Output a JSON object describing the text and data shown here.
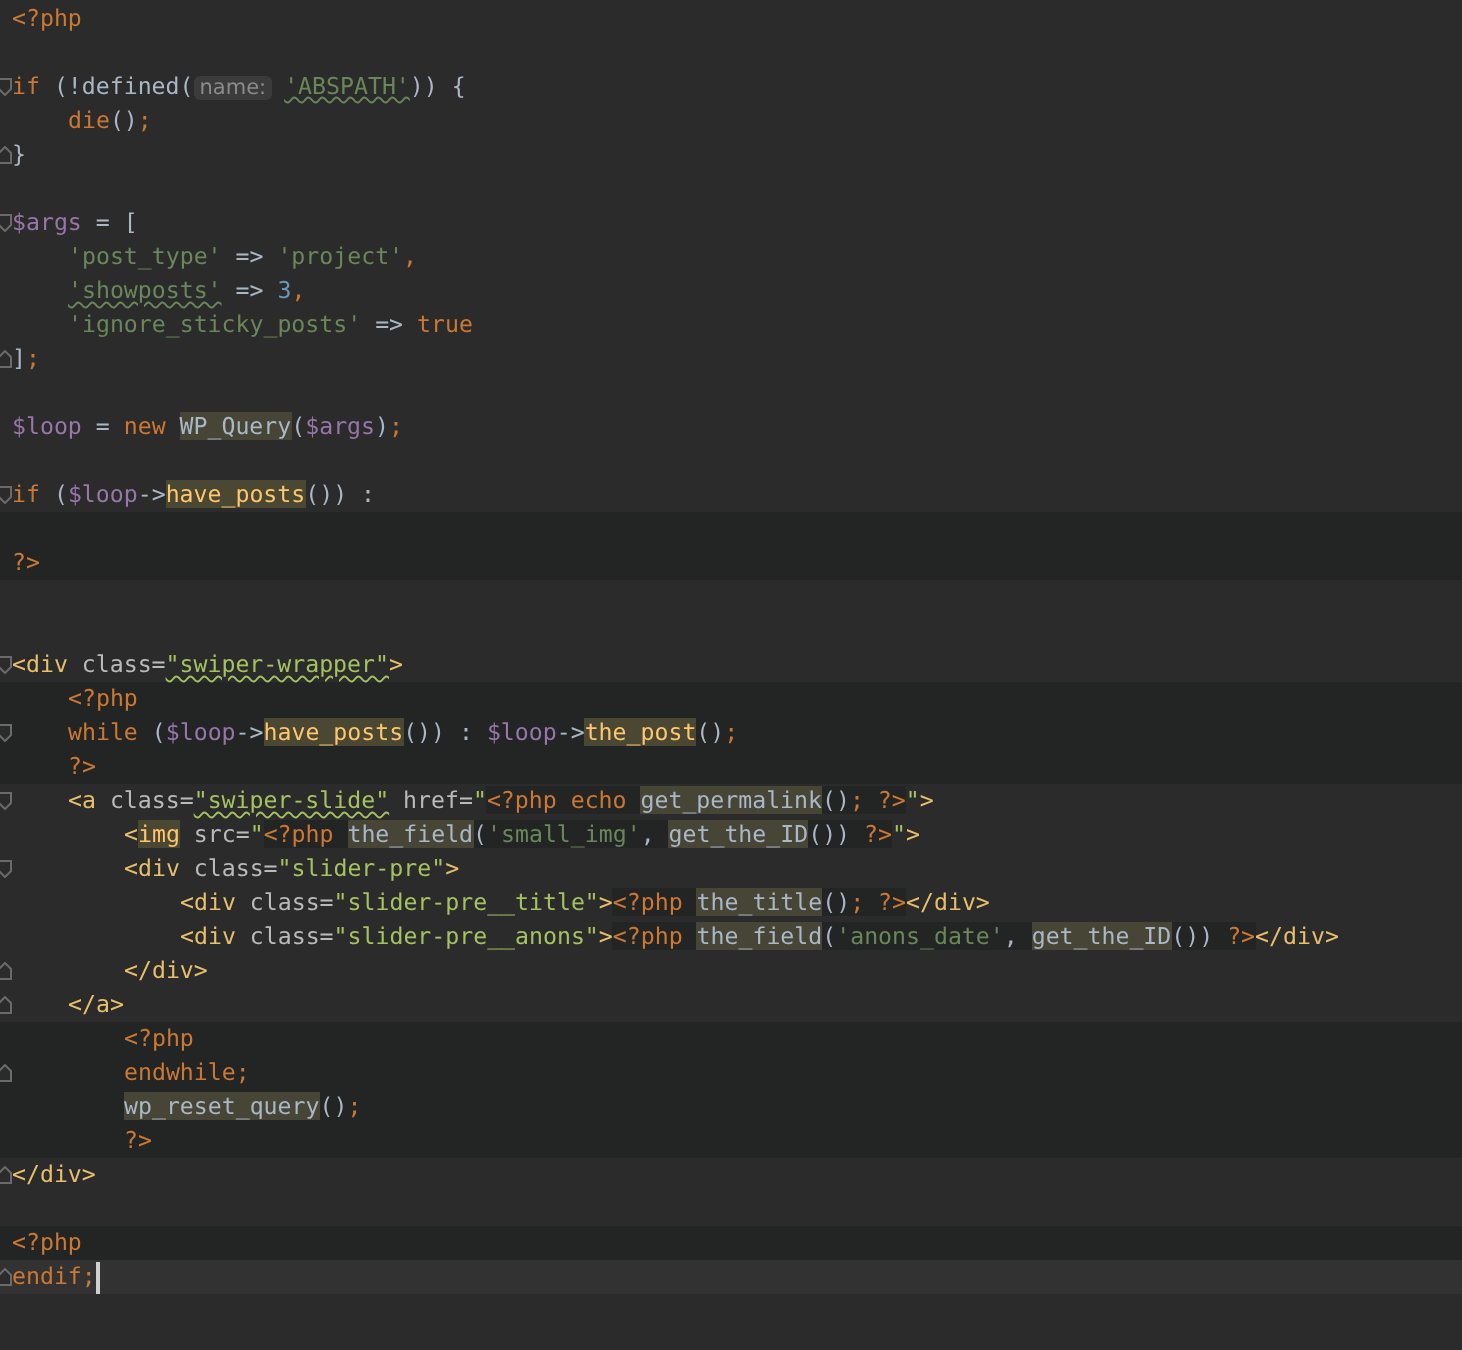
{
  "editor": {
    "lines": [
      {
        "kind": "flush",
        "fold_open": false,
        "fold_close": false,
        "php_block": false,
        "current_line": false,
        "segments": [
          {
            "kind": "code",
            "tokens": [
              {
                "text": "<?php",
                "kind": "php-tag"
              }
            ]
          }
        ]
      },
      {
        "kind": "flush"
      },
      {
        "kind": "flush",
        "fold_open": true,
        "fold_close": false,
        "php_block": false,
        "current_line": false,
        "segments": [
          {
            "kind": "code",
            "tokens": [
              {
                "text": "if",
                "kind": "kw"
              },
              {
                "text": " (!defined(",
                "kind": "op"
              },
              {
                "text": "name:",
                "kind": "hint"
              },
              {
                "text": "'ABSPATH'",
                "kind": "str-typo"
              },
              {
                "text": ")) {",
                "kind": "op"
              }
            ]
          }
        ]
      },
      {
        "kind": "single",
        "fold_open": false,
        "fold_close": false,
        "php_block": false,
        "current_line": false,
        "segments": [
          {
            "kind": "code",
            "tokens": [
              {
                "text": "die",
                "kind": "kw"
              },
              {
                "text": "()",
                "kind": "op"
              },
              {
                "text": ";",
                "kind": "kw"
              }
            ]
          }
        ]
      },
      {
        "kind": "flush",
        "fold_open": false,
        "fold_close": true,
        "php_block": false,
        "current_line": false,
        "segments": [
          {
            "kind": "code",
            "tokens": [
              {
                "text": "}",
                "kind": "op"
              }
            ]
          }
        ]
      },
      {
        "kind": "flush"
      },
      {
        "kind": "flush",
        "fold_open": true,
        "fold_close": false,
        "php_block": false,
        "current_line": false,
        "segments": [
          {
            "kind": "code",
            "tokens": [
              {
                "text": "$args",
                "kind": "var"
              },
              {
                "text": " = [",
                "kind": "op"
              }
            ]
          }
        ]
      },
      {
        "kind": "single",
        "fold_open": false,
        "fold_close": false,
        "php_block": false,
        "current_line": false,
        "segments": [
          {
            "kind": "code",
            "tokens": [
              {
                "text": "'post_type'",
                "kind": "str"
              },
              {
                "text": " => ",
                "kind": "op"
              },
              {
                "text": "'project'",
                "kind": "str"
              },
              {
                "text": ",",
                "kind": "kw"
              }
            ]
          }
        ]
      },
      {
        "kind": "single",
        "fold_open": false,
        "fold_close": false,
        "php_block": false,
        "current_line": false,
        "segments": [
          {
            "kind": "code",
            "tokens": [
              {
                "text": "'showposts'",
                "kind": "str-typo"
              },
              {
                "text": " => ",
                "kind": "op"
              },
              {
                "text": "3",
                "kind": "num"
              },
              {
                "text": ",",
                "kind": "kw"
              }
            ]
          }
        ]
      },
      {
        "kind": "single",
        "fold_open": false,
        "fold_close": false,
        "php_block": false,
        "current_line": false,
        "segments": [
          {
            "kind": "code",
            "tokens": [
              {
                "text": "'ignore_sticky_posts'",
                "kind": "str"
              },
              {
                "text": " => ",
                "kind": "op"
              },
              {
                "text": "true",
                "kind": "kw"
              }
            ]
          }
        ]
      },
      {
        "kind": "flush",
        "fold_open": false,
        "fold_close": true,
        "php_block": false,
        "current_line": false,
        "segments": [
          {
            "kind": "code",
            "tokens": [
              {
                "text": "]",
                "kind": "op"
              },
              {
                "text": ";",
                "kind": "kw"
              }
            ]
          }
        ]
      },
      {
        "kind": "flush"
      },
      {
        "kind": "flush",
        "fold_open": false,
        "fold_close": false,
        "php_block": false,
        "current_line": false,
        "segments": [
          {
            "kind": "code",
            "tokens": [
              {
                "text": "$loop",
                "kind": "var"
              },
              {
                "text": " = ",
                "kind": "op"
              },
              {
                "text": "new ",
                "kind": "kw"
              },
              {
                "text": "WP_Query",
                "kind": "name-hl"
              },
              {
                "text": "(",
                "kind": "op"
              },
              {
                "text": "$args",
                "kind": "var"
              },
              {
                "text": ")",
                "kind": "op"
              },
              {
                "text": ";",
                "kind": "kw"
              }
            ]
          }
        ]
      },
      {
        "kind": "flush"
      },
      {
        "kind": "flush",
        "fold_open": true,
        "fold_close": false,
        "php_block": false,
        "current_line": false,
        "segments": [
          {
            "kind": "code",
            "tokens": [
              {
                "text": "if",
                "kind": "kw"
              },
              {
                "text": " (",
                "kind": "op"
              },
              {
                "text": "$loop",
                "kind": "var"
              },
              {
                "text": "->",
                "kind": "op"
              },
              {
                "text": "have_posts",
                "kind": "fn-hl"
              },
              {
                "text": "()) :",
                "kind": "op"
              }
            ]
          }
        ]
      },
      {
        "kind": "flush",
        "fold_open": false,
        "fold_close": false,
        "php_block": true,
        "current_line": false
      },
      {
        "kind": "flush",
        "fold_open": false,
        "fold_close": false,
        "php_block": true,
        "current_line": false,
        "segments": [
          {
            "kind": "code",
            "tokens": [
              {
                "text": "?>",
                "kind": "php-tag"
              }
            ]
          }
        ]
      },
      {
        "kind": "flush"
      },
      {
        "kind": "flush"
      },
      {
        "kind": "flush",
        "fold_open": true,
        "fold_close": false,
        "php_block": false,
        "current_line": false,
        "segments": [
          {
            "kind": "code",
            "tokens": [
              {
                "text": "<div",
                "kind": "tag"
              },
              {
                "text": " class=",
                "kind": "attr"
              },
              {
                "text": "\"swiper-wrapper\"",
                "kind": "val-typo"
              },
              {
                "text": ">",
                "kind": "tag"
              }
            ]
          }
        ]
      },
      {
        "kind": "single",
        "fold_open": false,
        "fold_close": false,
        "php_block": true,
        "current_line": false,
        "segments": [
          {
            "kind": "code",
            "tokens": [
              {
                "text": "<?php",
                "kind": "php-tag"
              }
            ]
          }
        ]
      },
      {
        "kind": "single",
        "fold_open": true,
        "fold_close": false,
        "php_block": true,
        "current_line": false,
        "segments": [
          {
            "kind": "code",
            "tokens": [
              {
                "text": "while",
                "kind": "kw"
              },
              {
                "text": " (",
                "kind": "op"
              },
              {
                "text": "$loop",
                "kind": "var"
              },
              {
                "text": "->",
                "kind": "op"
              },
              {
                "text": "have_posts",
                "kind": "fn-hl"
              },
              {
                "text": "()) : ",
                "kind": "op"
              },
              {
                "text": "$loop",
                "kind": "var"
              },
              {
                "text": "->",
                "kind": "op"
              },
              {
                "text": "the_post",
                "kind": "fn-hl"
              },
              {
                "text": "()",
                "kind": "op"
              },
              {
                "text": ";",
                "kind": "kw"
              }
            ]
          }
        ]
      },
      {
        "kind": "single",
        "fold_open": false,
        "fold_close": false,
        "php_block": true,
        "current_line": false,
        "segments": [
          {
            "kind": "code",
            "tokens": [
              {
                "text": "?>",
                "kind": "php-tag"
              }
            ]
          }
        ]
      },
      {
        "kind": "single",
        "fold_open": true,
        "fold_close": false,
        "php_block": false,
        "current_line": false,
        "segments": [
          {
            "kind": "code",
            "tokens": [
              {
                "text": "<a",
                "kind": "tag"
              },
              {
                "text": " class=",
                "kind": "attr"
              },
              {
                "text": "\"swiper-slide\"",
                "kind": "val-typo"
              },
              {
                "text": " href=",
                "kind": "attr"
              },
              {
                "text": "\"",
                "kind": "val"
              }
            ]
          },
          {
            "kind": "php",
            "tokens": [
              {
                "text": "<?php",
                "kind": "php-tag"
              },
              {
                "text": " echo ",
                "kind": "kw"
              },
              {
                "text": "get_permalink",
                "kind": "name-hl"
              },
              {
                "text": "()",
                "kind": "op"
              },
              {
                "text": ";",
                "kind": "kw"
              },
              {
                "text": " ?>",
                "kind": "php-tag"
              }
            ]
          },
          {
            "kind": "code",
            "tokens": [
              {
                "text": "\"",
                "kind": "val"
              },
              {
                "text": ">",
                "kind": "tag"
              }
            ]
          }
        ]
      },
      {
        "kind": "double",
        "fold_open": false,
        "fold_close": false,
        "php_block": false,
        "current_line": false,
        "segments": [
          {
            "kind": "code",
            "tokens": [
              {
                "text": "<",
                "kind": "tag"
              },
              {
                "text": "img",
                "kind": "fn-hl"
              },
              {
                "text": " src=",
                "kind": "attr"
              },
              {
                "text": "\"",
                "kind": "val"
              }
            ]
          },
          {
            "kind": "php",
            "tokens": [
              {
                "text": "<?php ",
                "kind": "php-tag"
              },
              {
                "text": "the_field",
                "kind": "name-hl"
              },
              {
                "text": "(",
                "kind": "op"
              },
              {
                "text": "'small_img'",
                "kind": "str"
              },
              {
                "text": ", ",
                "kind": "op"
              },
              {
                "text": "get_the_ID",
                "kind": "name-hl"
              },
              {
                "text": "()) ",
                "kind": "op"
              },
              {
                "text": "?>",
                "kind": "php-tag"
              }
            ]
          },
          {
            "kind": "code",
            "tokens": [
              {
                "text": "\"",
                "kind": "val"
              },
              {
                "text": ">",
                "kind": "tag"
              }
            ]
          }
        ]
      },
      {
        "kind": "double",
        "fold_open": true,
        "fold_close": false,
        "php_block": false,
        "current_line": false,
        "segments": [
          {
            "kind": "code",
            "tokens": [
              {
                "text": "<div",
                "kind": "tag"
              },
              {
                "text": " class=",
                "kind": "attr"
              },
              {
                "text": "\"slider-pre\"",
                "kind": "val"
              },
              {
                "text": ">",
                "kind": "tag"
              }
            ]
          }
        ]
      },
      {
        "kind": "triple",
        "fold_open": false,
        "fold_close": false,
        "php_block": false,
        "current_line": false,
        "segments": [
          {
            "kind": "code",
            "tokens": [
              {
                "text": "<div",
                "kind": "tag"
              },
              {
                "text": " class=",
                "kind": "attr"
              },
              {
                "text": "\"slider-pre__title\"",
                "kind": "val"
              },
              {
                "text": ">",
                "kind": "tag"
              }
            ]
          },
          {
            "kind": "php",
            "tokens": [
              {
                "text": "<?php ",
                "kind": "php-tag"
              },
              {
                "text": "the_title",
                "kind": "name-hl"
              },
              {
                "text": "()",
                "kind": "op"
              },
              {
                "text": ";",
                "kind": "kw"
              },
              {
                "text": " ?>",
                "kind": "php-tag"
              }
            ]
          },
          {
            "kind": "code",
            "tokens": [
              {
                "text": "</div>",
                "kind": "tag"
              }
            ]
          }
        ]
      },
      {
        "kind": "triple",
        "fold_open": false,
        "fold_close": false,
        "php_block": false,
        "current_line": false,
        "segments": [
          {
            "kind": "code",
            "tokens": [
              {
                "text": "<div",
                "kind": "tag"
              },
              {
                "text": " class=",
                "kind": "attr"
              },
              {
                "text": "\"slider-pre__anons\"",
                "kind": "val"
              },
              {
                "text": ">",
                "kind": "tag"
              }
            ]
          },
          {
            "kind": "php",
            "tokens": [
              {
                "text": "<?php ",
                "kind": "php-tag"
              },
              {
                "text": "the_field",
                "kind": "name-hl"
              },
              {
                "text": "(",
                "kind": "op"
              },
              {
                "text": "'anons_date'",
                "kind": "str"
              },
              {
                "text": ", ",
                "kind": "op"
              },
              {
                "text": "get_the_ID",
                "kind": "name-hl"
              },
              {
                "text": "()) ",
                "kind": "op"
              },
              {
                "text": "?>",
                "kind": "php-tag"
              }
            ]
          },
          {
            "kind": "code",
            "tokens": [
              {
                "text": "</div>",
                "kind": "tag"
              }
            ]
          }
        ]
      },
      {
        "kind": "double",
        "fold_open": false,
        "fold_close": true,
        "php_block": false,
        "current_line": false,
        "segments": [
          {
            "kind": "code",
            "tokens": [
              {
                "text": "</div>",
                "kind": "tag"
              }
            ]
          }
        ]
      },
      {
        "kind": "single",
        "fold_open": false,
        "fold_close": true,
        "php_block": false,
        "current_line": false,
        "segments": [
          {
            "kind": "code",
            "tokens": [
              {
                "text": "</a>",
                "kind": "tag"
              }
            ]
          }
        ]
      },
      {
        "kind": "double",
        "fold_open": false,
        "fold_close": false,
        "php_block": true,
        "current_line": false,
        "segments": [
          {
            "kind": "code",
            "tokens": [
              {
                "text": "<?php",
                "kind": "php-tag"
              }
            ]
          }
        ]
      },
      {
        "kind": "double",
        "fold_open": false,
        "fold_close": true,
        "php_block": true,
        "current_line": false,
        "segments": [
          {
            "kind": "code",
            "tokens": [
              {
                "text": "endwhile",
                "kind": "kw"
              },
              {
                "text": ";",
                "kind": "kw"
              }
            ]
          }
        ]
      },
      {
        "kind": "double",
        "fold_open": false,
        "fold_close": false,
        "php_block": true,
        "current_line": false,
        "segments": [
          {
            "kind": "code",
            "tokens": [
              {
                "text": "wp_reset_query",
                "kind": "name-hl"
              },
              {
                "text": "()",
                "kind": "op"
              },
              {
                "text": ";",
                "kind": "kw"
              }
            ]
          }
        ]
      },
      {
        "kind": "double",
        "fold_open": false,
        "fold_close": false,
        "php_block": true,
        "current_line": false,
        "segments": [
          {
            "kind": "code",
            "tokens": [
              {
                "text": "?>",
                "kind": "php-tag"
              }
            ]
          }
        ]
      },
      {
        "kind": "flush",
        "fold_open": false,
        "fold_close": true,
        "php_block": false,
        "current_line": false,
        "segments": [
          {
            "kind": "code",
            "tokens": [
              {
                "text": "</div>",
                "kind": "tag"
              }
            ]
          }
        ]
      },
      {
        "kind": "flush"
      },
      {
        "kind": "flush",
        "fold_open": false,
        "fold_close": false,
        "php_block": true,
        "current_line": false,
        "segments": [
          {
            "kind": "code",
            "tokens": [
              {
                "text": "<?php",
                "kind": "php-tag"
              }
            ]
          }
        ]
      },
      {
        "kind": "flush",
        "fold_open": false,
        "fold_close": true,
        "php_block": false,
        "current_line": true,
        "segments": [
          {
            "kind": "code",
            "tokens": [
              {
                "text": "endif",
                "kind": "kw"
              },
              {
                "text": ";",
                "kind": "kw"
              }
            ]
          }
        ]
      }
    ]
  }
}
